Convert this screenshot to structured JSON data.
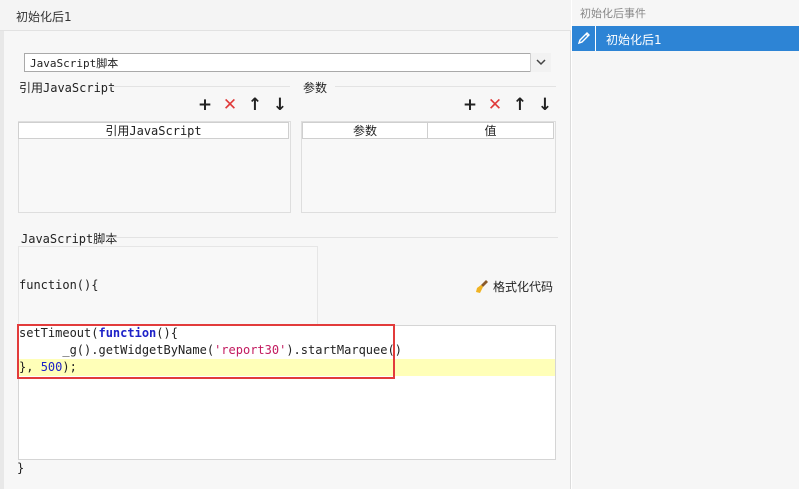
{
  "dialog": {
    "title": "初始化后1"
  },
  "script_type_select": {
    "value": "JavaScript脚本",
    "arrow": "chevron-down"
  },
  "ref_js": {
    "section_label": "引用JavaScript",
    "column_header": "引用JavaScript",
    "tools": {
      "add": "+",
      "delete": "✕",
      "up": "↑",
      "down": "↓"
    }
  },
  "params": {
    "section_label": "参数",
    "columns": [
      "参数",
      "值"
    ],
    "tools": {
      "add": "+",
      "delete": "✕",
      "up": "↑",
      "down": "↓"
    }
  },
  "js_script": {
    "section_label": "JavaScript脚本",
    "function_head": "function(){",
    "function_tail": "}",
    "format_button": "格式化代码",
    "code": {
      "l1_a": "setTimeout(",
      "l1_kw": "function",
      "l1_b": "(){",
      "l2_a": "      _g().getWidgetByName(",
      "l2_str": "'report30'",
      "l2_b": ").startMarquee()",
      "l3_a": "}, ",
      "l3_num": "500",
      "l3_b": ");"
    }
  },
  "events_panel": {
    "title": "初始化后事件",
    "items": [
      {
        "label": "初始化后1",
        "icon": "pencil-icon"
      }
    ]
  },
  "colors": {
    "accent": "#2d84d5",
    "delete": "#e03a3a",
    "highlight_box": "#e23b3b",
    "keyword": "#1e22c8",
    "string": "#c21a5e"
  }
}
